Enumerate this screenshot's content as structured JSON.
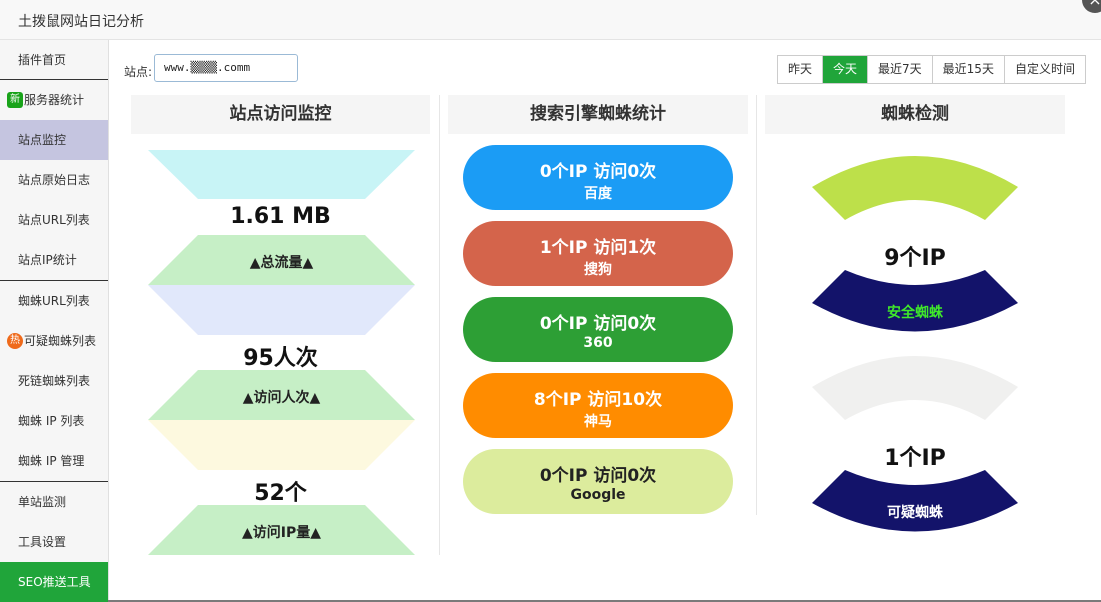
{
  "window": {
    "title": "土拨鼠网站日记分析",
    "close": "×"
  },
  "sidebar": {
    "items": [
      {
        "label": "插件首页"
      },
      {
        "label": "服务器统计",
        "badge": "新"
      },
      {
        "label": "站点监控"
      },
      {
        "label": "站点原始日志"
      },
      {
        "label": "站点URL列表"
      },
      {
        "label": "站点IP统计"
      },
      {
        "label": "蜘蛛URL列表"
      },
      {
        "label": "可疑蜘蛛列表",
        "badge": "热"
      },
      {
        "label": "死链蜘蛛列表"
      },
      {
        "label": "蜘蛛 IP 列表"
      },
      {
        "label": "蜘蛛 IP 管理"
      },
      {
        "label": "单站监测"
      },
      {
        "label": "工具设置"
      },
      {
        "label": "SEO推送工具"
      }
    ]
  },
  "toolbar": {
    "site_label": "站点:",
    "site_value": "www.▒▒▒▒.comm",
    "time_buttons": [
      "昨天",
      "今天",
      "最近7天",
      "最近15天",
      "自定义时间"
    ],
    "selected_time": "今天"
  },
  "monitor": {
    "title": "站点访问监控",
    "traffic_value": "1.61 MB",
    "traffic_label": "▲总流量▲",
    "visits_value": "95人次",
    "visits_label": "▲访问人次▲",
    "ip_value": "52个",
    "ip_label": "▲访问IP量▲"
  },
  "search_engines": {
    "title": "搜索引擎蜘蛛统计",
    "items": [
      {
        "stats": "0个IP 访问0次",
        "name": "百度",
        "color": "#1b9cf5"
      },
      {
        "stats": "1个IP 访问1次",
        "name": "搜狗",
        "color": "#d4644b"
      },
      {
        "stats": "0个IP 访问0次",
        "name": "360",
        "color": "#2d9f35"
      },
      {
        "stats": "8个IP 访问10次",
        "name": "神马",
        "color": "#ff8c00"
      },
      {
        "stats": "0个IP 访问0次",
        "name": "Google",
        "color": "#dcec9d"
      }
    ]
  },
  "spider_detect": {
    "title": "蜘蛛检测",
    "safe_count": "9个IP",
    "safe_label": "安全蜘蛛",
    "suspicious_count": "1个IP",
    "suspicious_label": "可疑蜘蛛",
    "colors": {
      "safe_top": "#bde04a",
      "navy": "#13136a",
      "suspicious_top": "#f0f0ef",
      "safe_text": "#3fe82a"
    }
  }
}
